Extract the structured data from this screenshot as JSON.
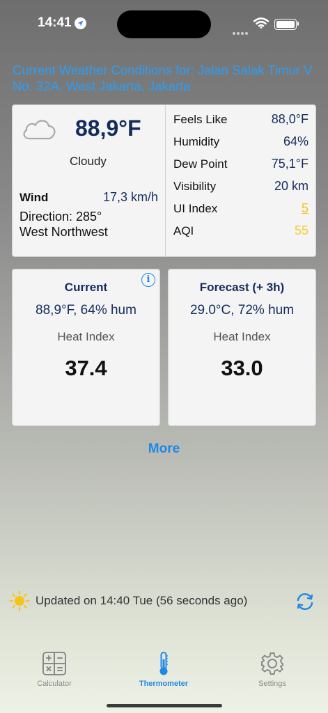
{
  "status": {
    "time": "14:41"
  },
  "header": {
    "title": "Current Weather Conditions for: Jalan Salak Timur V No. 32A, West Jakarta, Jakarta"
  },
  "current": {
    "temperature": "88,9°F",
    "condition": "Cloudy",
    "wind_label": "Wind",
    "wind_value": "17,3 km/h",
    "direction": "Direction: 285°",
    "direction_name": "West Northwest"
  },
  "stats": [
    {
      "label": "Feels Like",
      "value": "88,0°F"
    },
    {
      "label": "Humidity",
      "value": "64%"
    },
    {
      "label": "Dew Point",
      "value": "75,1°F"
    },
    {
      "label": "Visibility",
      "value": "20 km"
    },
    {
      "label": "UI Index",
      "value": "5"
    },
    {
      "label": "AQI",
      "value": "55"
    }
  ],
  "heat_cards": [
    {
      "title": "Current",
      "line": "88,9°F, 64% hum",
      "label": "Heat Index",
      "value": "37.4"
    },
    {
      "title": "Forecast (+ 3h)",
      "line": "29.0°C, 72% hum",
      "label": "Heat Index",
      "value": "33.0"
    }
  ],
  "more_label": "More",
  "updated_text": "Updated on 14:40 Tue (56 seconds ago)",
  "tabs": [
    {
      "label": "Calculator"
    },
    {
      "label": "Thermometer"
    },
    {
      "label": "Settings"
    }
  ],
  "colors": {
    "accent": "#1e88e5",
    "header": "#2f9df2",
    "navy": "#142c5c",
    "uv": "#f2c11b",
    "aqi": "#f5cd38"
  },
  "icons": {
    "weather": "cloud-icon",
    "info": "info-icon",
    "sun": "sun-icon",
    "refresh": "refresh-icon",
    "calculator": "calculator-icon",
    "thermometer": "thermometer-icon",
    "settings": "gear-icon"
  }
}
